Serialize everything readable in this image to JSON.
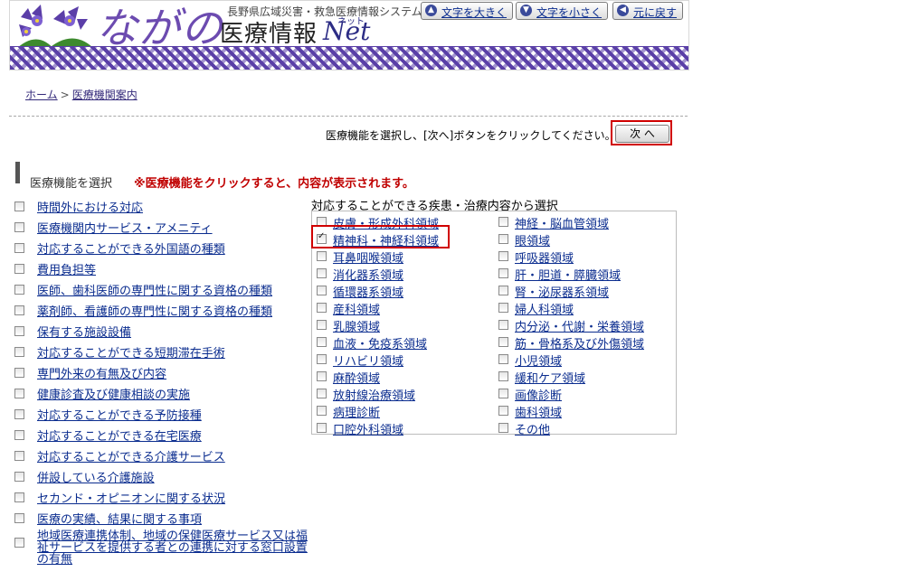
{
  "header": {
    "logo_text": "ながの",
    "subtitle": "長野県広域災害・救急医療情報システム",
    "title": "医療情報",
    "net_label": "Net",
    "net_ruby": "ネット",
    "buttons": [
      {
        "label": "文字を大きく",
        "icon": "arrow-up-icon"
      },
      {
        "label": "文字を小さく",
        "icon": "arrow-down-icon"
      },
      {
        "label": "元に戻す",
        "icon": "arrow-left-icon"
      }
    ],
    "brand_color": "#5a3fa7"
  },
  "breadcrumb": {
    "home": "ホーム",
    "separator": ">",
    "current": "医療機関案内"
  },
  "instruction": "医療機能を選択し、[次へ]ボタンをクリックしてください。→",
  "next_button": "次 へ",
  "section": {
    "mark": "!",
    "title": "医療機能を選択",
    "note": "※医療機能をクリックすると、内容が表示されます。"
  },
  "functions": [
    "時間外における対応",
    "医療機関内サービス・アメニティ",
    "対応することができる外国語の種類",
    "費用負担等",
    "医師、歯科医師の専門性に関する資格の種類",
    "薬剤師、看護師の専門性に関する資格の種類",
    "保有する施設設備",
    "対応することができる短期滞在手術",
    "専門外来の有無及び内容",
    "健康診査及び健康相談の実施",
    "対応することができる予防接種",
    "対応することができる在宅医療",
    "対応することができる介護サービス",
    "併設している介護施設",
    "セカンド・オピニオンに関する状況",
    "医療の実績、結果に関する事項",
    "地域医療連携体制、地域の保健医療サービス又は福祉サービスを提供する者との連携に対する窓口設置の有無"
  ],
  "disease": {
    "title": "対応することができる疾患・治療内容から選択",
    "left": [
      {
        "label": "皮膚・形成外科領域",
        "checked": false
      },
      {
        "label": "精神科・神経科領域",
        "checked": true
      },
      {
        "label": "耳鼻咽喉領域",
        "checked": false
      },
      {
        "label": "消化器系領域",
        "checked": false
      },
      {
        "label": "循環器系領域",
        "checked": false
      },
      {
        "label": "産科領域",
        "checked": false
      },
      {
        "label": "乳腺領域",
        "checked": false
      },
      {
        "label": "血液・免疫系領域",
        "checked": false
      },
      {
        "label": "リハビリ領域",
        "checked": false
      },
      {
        "label": "麻酔領域",
        "checked": false
      },
      {
        "label": "放射線治療領域",
        "checked": false
      },
      {
        "label": "病理診断",
        "checked": false
      },
      {
        "label": "口腔外科領域",
        "checked": false
      }
    ],
    "right": [
      {
        "label": "神経・脳血管領域",
        "checked": false
      },
      {
        "label": "眼領域",
        "checked": false
      },
      {
        "label": "呼吸器領域",
        "checked": false
      },
      {
        "label": "肝・胆道・膵臓領域",
        "checked": false
      },
      {
        "label": "腎・泌尿器系領域",
        "checked": false
      },
      {
        "label": "婦人科領域",
        "checked": false
      },
      {
        "label": "内分泌・代謝・栄養領域",
        "checked": false
      },
      {
        "label": "筋・骨格系及び外傷領域",
        "checked": false
      },
      {
        "label": "小児領域",
        "checked": false
      },
      {
        "label": "緩和ケア領域",
        "checked": false
      },
      {
        "label": "画像診断",
        "checked": false
      },
      {
        "label": "歯科領域",
        "checked": false
      },
      {
        "label": "その他",
        "checked": false
      }
    ]
  }
}
